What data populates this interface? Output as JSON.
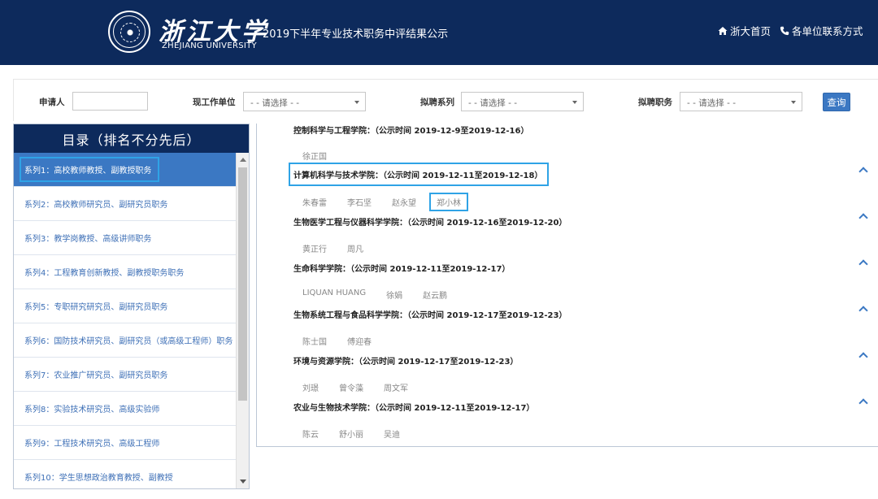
{
  "header": {
    "logo_name": "浙江大学",
    "logo_en": "ZHEJIANG UNIVERSITY",
    "site_title": "2019下半年专业技术职务中评结果公示",
    "nav_home": "浙大首页",
    "nav_contact": "各单位联系方式",
    "home_icon": "home-icon",
    "phone_icon": "phone-icon"
  },
  "search": {
    "applicant_label": "申请人",
    "applicant_value": "",
    "unit_label": "现工作单位",
    "unit_value": "- - 请选择 - -",
    "series_label": "拟聘系列",
    "series_value": "- - 请选择 - -",
    "position_label": "拟聘职务",
    "position_value": "- - 请选择 - -",
    "query_button": "查询",
    "accent_color": "#3b78c3"
  },
  "sidebar": {
    "title": "目录（排名不分先后）",
    "items": [
      {
        "label": "系列1：高校教师教授、副教授职务",
        "active": true
      },
      {
        "label": "系列2：高校教师研究员、副研究员职务"
      },
      {
        "label": "系列3：教学岗教授、高级讲师职务"
      },
      {
        "label": "系列4：工程教育创新教授、副教授职务职务"
      },
      {
        "label": "系列5：专职研究研究员、副研究员职务"
      },
      {
        "label": "系列6：国防技术研究员、副研究员（或高级工程师）职务"
      },
      {
        "label": "系列7：农业推广研究员、副研究员职务"
      },
      {
        "label": "系列8：实验技术研究员、高级实验师"
      },
      {
        "label": "系列9：工程技术研究员、高级工程师"
      },
      {
        "label": "系列10：学生思想政治教育教授、副教授"
      }
    ]
  },
  "main": {
    "colleges": [
      {
        "title": "控制科学与工程学院：（公示时间 2019-12-9至2019-12-16）",
        "names": [
          "徐正国"
        ]
      },
      {
        "title": "计算机科学与技术学院：（公示时间 2019-12-11至2019-12-18）",
        "names": [
          "朱春雷",
          "李石坚",
          "赵永望",
          "郑小林"
        ],
        "highlight": true,
        "highlight_name": "郑小林"
      },
      {
        "title": "生物医学工程与仪器科学学院：（公示时间 2019-12-16至2019-12-20）",
        "names": [
          "黄正行",
          "周凡"
        ]
      },
      {
        "title": "生命科学学院：（公示时间 2019-12-11至2019-12-17）",
        "names": [
          "LIQUAN HUANG",
          "徐娟",
          "赵云鹏"
        ]
      },
      {
        "title": "生物系统工程与食品科学学院：（公示时间 2019-12-17至2019-12-23）",
        "names": [
          "陈士国",
          "傅迎春"
        ]
      },
      {
        "title": "环境与资源学院：（公示时间 2019-12-17至2019-12-23）",
        "names": [
          "刘璟",
          "曾令藻",
          "周文军"
        ]
      },
      {
        "title": "农业与生物技术学院：（公示时间 2019-12-11至2019-12-17）",
        "names": [
          "陈云",
          "舒小丽",
          "吴迪"
        ]
      }
    ]
  }
}
